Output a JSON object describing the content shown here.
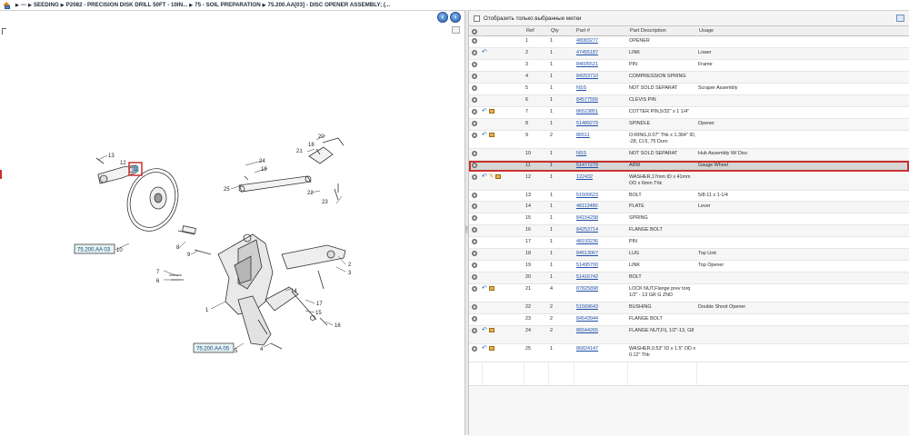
{
  "breadcrumb": {
    "home_icon": "home-icon",
    "items": [
      "---",
      "SEEDING",
      "P2082 - PRECISION DISK DRILL 50FT - 10IN...",
      "75 - SOIL PREPARATION",
      "75.200.AA[03] - DISC OPENER ASSEMBLY; (..."
    ]
  },
  "nav": {
    "back_icon": "back-arrow-icon",
    "forward_icon": "forward-arrow-icon"
  },
  "drawing": {
    "callouts": {
      "ref_top": "75.200.AA 03",
      "ref_bottom": "75.200.AA 05"
    },
    "labels": [
      "1",
      "2",
      "3",
      "4",
      "5",
      "6",
      "7",
      "8",
      "9",
      "10",
      "11",
      "12",
      "13",
      "14",
      "15",
      "16",
      "17",
      "18",
      "19",
      "20",
      "21",
      "22",
      "23",
      "24",
      "25"
    ],
    "highlighted": "11"
  },
  "parts": {
    "filter_label": "Отобразить только выбранные метки",
    "columns": {
      "ref": "Ref",
      "qty": "Qty",
      "part": "Part #",
      "desc": "Part Description",
      "usage": "Usage"
    },
    "rows": [
      {
        "ref": "1",
        "qty": "1",
        "part": "48083277",
        "desc": "OPENER",
        "usage": "",
        "icons": []
      },
      {
        "ref": "2",
        "qty": "1",
        "part": "47455187",
        "desc": "LINK",
        "usage": "Lower",
        "icons": [
          "undo"
        ]
      },
      {
        "ref": "3",
        "qty": "1",
        "part": "84605521",
        "desc": "PIN",
        "usage": "Frame",
        "icons": []
      },
      {
        "ref": "4",
        "qty": "1",
        "part": "84253710",
        "desc": "COMPRESSION SPRING",
        "usage": "",
        "icons": []
      },
      {
        "ref": "5",
        "qty": "1",
        "part": "NSS",
        "desc": "NOT SOLD SEPARAT",
        "usage": "Scraper Assembly",
        "icons": []
      },
      {
        "ref": "6",
        "qty": "1",
        "part": "84577556",
        "desc": "CLEVIS PIN",
        "usage": "",
        "icons": []
      },
      {
        "ref": "7",
        "qty": "1",
        "part": "86523851",
        "desc": "COTTER PIN,5/32\" x 1 1/4\"",
        "usage": "",
        "icons": [
          "undo",
          "box"
        ]
      },
      {
        "ref": "8",
        "qty": "1",
        "part": "51489279",
        "desc": "SPINDLE",
        "usage": "Opener",
        "icons": []
      },
      {
        "ref": "9",
        "qty": "2",
        "part": "86511",
        "desc": "O-RING,0.07\" Thk x 1.364\" ID, -28, Cl.5, 75 Duro",
        "usage": "",
        "icons": [
          "undo",
          "box"
        ]
      },
      {
        "ref": "10",
        "qty": "1",
        "part": "NSS",
        "desc": "NOT SOLD SEPARAT",
        "usage": "Hub Assembly W/ Disc",
        "icons": []
      },
      {
        "ref": "11",
        "qty": "1",
        "part": "51477279",
        "desc": "ARM",
        "usage": "Gauge Wheel",
        "icons": [],
        "selected": true
      },
      {
        "ref": "12",
        "qty": "1",
        "part": "122432",
        "desc": "WASHER,17mm ID x 41mm OD x 6mm Thk",
        "usage": "",
        "icons": [
          "undo",
          "pencil",
          "box"
        ]
      },
      {
        "ref": "13",
        "qty": "1",
        "part": "51500623",
        "desc": "BOLT",
        "usage": "5/8-11 x 1-1/4",
        "icons": []
      },
      {
        "ref": "14",
        "qty": "1",
        "part": "48113480",
        "desc": "PLATE",
        "usage": "Lever",
        "icons": []
      },
      {
        "ref": "15",
        "qty": "1",
        "part": "84154298",
        "desc": "SPRING",
        "usage": "",
        "icons": []
      },
      {
        "ref": "16",
        "qty": "1",
        "part": "84253714",
        "desc": "FLANGE BOLT",
        "usage": "",
        "icons": []
      },
      {
        "ref": "17",
        "qty": "1",
        "part": "48193236",
        "desc": "PIN",
        "usage": "",
        "icons": []
      },
      {
        "ref": "18",
        "qty": "1",
        "part": "84513067",
        "desc": "LUG",
        "usage": "Top Link",
        "icons": []
      },
      {
        "ref": "19",
        "qty": "1",
        "part": "51495700",
        "desc": "LINK",
        "usage": "Top Opener",
        "icons": []
      },
      {
        "ref": "20",
        "qty": "1",
        "part": "51416742",
        "desc": "BOLT",
        "usage": "",
        "icons": []
      },
      {
        "ref": "21",
        "qty": "4",
        "part": "87825898",
        "desc": "LOCK NUT,Flange prev torq 1/2\" - 13 GR G ZND",
        "usage": "",
        "icons": [
          "undo",
          "box"
        ]
      },
      {
        "ref": "22",
        "qty": "2",
        "part": "51569643",
        "desc": "BUSHING",
        "usage": "Double Shoot Opener",
        "icons": []
      },
      {
        "ref": "23",
        "qty": "2",
        "part": "84543944",
        "desc": "FLANGE BOLT",
        "usage": "",
        "icons": []
      },
      {
        "ref": "24",
        "qty": "2",
        "part": "86544265",
        "desc": "FLANGE NUT,Fl|, 1/2\"-13, G8",
        "usage": "",
        "icons": [
          "undo",
          "box"
        ]
      },
      {
        "ref": "25",
        "qty": "1",
        "part": "86824147",
        "desc": "WASHER,0.53\" ID x 1.5\" OD x 0.12\" Thk",
        "usage": "",
        "icons": [
          "undo",
          "box"
        ]
      }
    ]
  }
}
